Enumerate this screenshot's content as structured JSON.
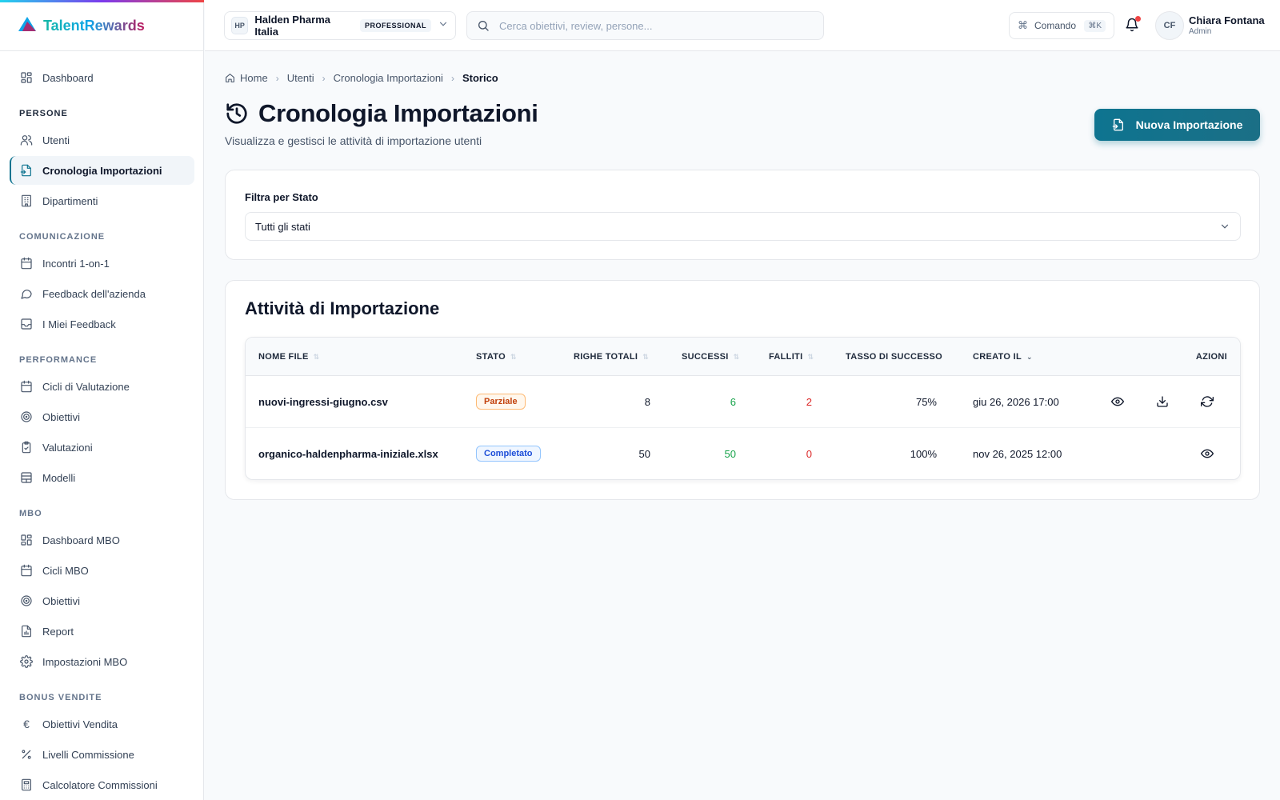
{
  "brand": {
    "name": "TalentRewards"
  },
  "sidebar": {
    "items": [
      {
        "type": "item",
        "label": "Dashboard",
        "icon": "dashboard-grid-icon"
      },
      {
        "type": "section",
        "label": "PERSONE"
      },
      {
        "type": "item",
        "label": "Utenti",
        "icon": "users-icon"
      },
      {
        "type": "item",
        "label": "Cronologia Importazioni",
        "icon": "file-import-icon",
        "active": true
      },
      {
        "type": "item",
        "label": "Dipartimenti",
        "icon": "building-icon"
      },
      {
        "type": "section",
        "label": "COMUNICAZIONE"
      },
      {
        "type": "item",
        "label": "Incontri 1-on-1",
        "icon": "calendar-icon"
      },
      {
        "type": "item",
        "label": "Feedback dell'azienda",
        "icon": "chat-bubble-icon"
      },
      {
        "type": "item",
        "label": "I Miei Feedback",
        "icon": "inbox-icon"
      },
      {
        "type": "section",
        "label": "PERFORMANCE"
      },
      {
        "type": "item",
        "label": "Cicli di Valutazione",
        "icon": "calendar-icon"
      },
      {
        "type": "item",
        "label": "Obiettivi",
        "icon": "target-icon"
      },
      {
        "type": "item",
        "label": "Valutazioni",
        "icon": "clipboard-check-icon"
      },
      {
        "type": "item",
        "label": "Modelli",
        "icon": "template-icon"
      },
      {
        "type": "section",
        "label": "MBO"
      },
      {
        "type": "item",
        "label": "Dashboard MBO",
        "icon": "dashboard-grid-icon"
      },
      {
        "type": "item",
        "label": "Cicli MBO",
        "icon": "calendar-icon"
      },
      {
        "type": "item",
        "label": "Obiettivi",
        "icon": "target-icon"
      },
      {
        "type": "item",
        "label": "Report",
        "icon": "report-icon"
      },
      {
        "type": "item",
        "label": "Impostazioni MBO",
        "icon": "gear-icon"
      },
      {
        "type": "section",
        "label": "BONUS VENDITE"
      },
      {
        "type": "item",
        "label": "Obiettivi Vendita",
        "icon": "euro-icon"
      },
      {
        "type": "item",
        "label": "Livelli Commissione",
        "icon": "percent-icon"
      },
      {
        "type": "item",
        "label": "Calcolatore Commissioni",
        "icon": "calculator-icon"
      }
    ]
  },
  "header": {
    "org": {
      "initials": "HP",
      "name": "Halden Pharma Italia",
      "plan": "PROFESSIONAL"
    },
    "search": {
      "placeholder": "Cerca obiettivi, review, persone..."
    },
    "command": {
      "label": "Comando",
      "shortcut": "⌘K"
    },
    "notifications": {
      "has_unread": true
    },
    "user": {
      "initials": "CF",
      "name": "Chiara Fontana",
      "role": "Admin"
    }
  },
  "breadcrumb": [
    "Home",
    "Utenti",
    "Cronologia Importazioni",
    "Storico"
  ],
  "page": {
    "title": "Cronologia Importazioni",
    "subtitle": "Visualizza e gestisci le attività di importazione utenti",
    "new_button": "Nuova Importazione"
  },
  "filter": {
    "label": "Filtra per Stato",
    "value": "Tutti gli stati"
  },
  "imports": {
    "title": "Attività di Importazione",
    "columns": [
      "NOME FILE",
      "STATO",
      "RIGHE TOTALI",
      "SUCCESSI",
      "FALLITI",
      "TASSO DI SUCCESSO",
      "CREATO IL",
      "AZIONI"
    ],
    "rows": [
      {
        "file": "nuovi-ingressi-giugno.csv",
        "status": "Parziale",
        "status_kind": "partial",
        "total": "8",
        "success": "6",
        "failed": "2",
        "rate": "75%",
        "created": "giu 26, 2026 17:00",
        "actions": [
          "view",
          "download",
          "retry"
        ]
      },
      {
        "file": "organico-haldenpharma-iniziale.xlsx",
        "status": "Completato",
        "status_kind": "done",
        "total": "50",
        "success": "50",
        "failed": "0",
        "rate": "100%",
        "created": "nov 26, 2025 12:00",
        "actions": [
          "view"
        ]
      }
    ]
  },
  "colors": {
    "accent": "#0e7490",
    "success": "#16a34a",
    "danger": "#dc2626",
    "partial": "#c2410c",
    "complete": "#1d4ed8"
  }
}
